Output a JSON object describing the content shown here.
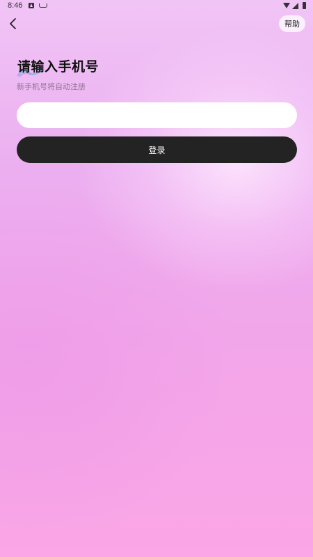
{
  "status_bar": {
    "time": "8:46",
    "icons": [
      "notification-a-icon",
      "notification-b-icon",
      "wifi-icon",
      "signal-icon",
      "battery-icon"
    ]
  },
  "header": {
    "back_icon": "chevron-left-icon",
    "help_label": "帮助"
  },
  "main": {
    "title": "请输入手机号",
    "subtitle": "新手机号将自动注册",
    "phone_input": {
      "value": "",
      "placeholder": ""
    },
    "login_label": "登录"
  },
  "colors": {
    "background_top": "#f1c4f6",
    "background_bottom": "#fba6e6",
    "button_bg": "#232323",
    "button_text": "#ffffff",
    "subtitle": "#8e7390",
    "decoration_accent": "#7fb8e8"
  }
}
